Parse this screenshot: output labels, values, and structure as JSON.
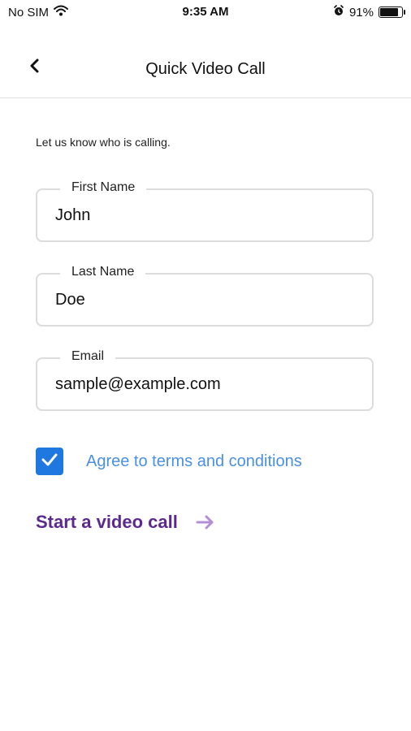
{
  "status_bar": {
    "carrier": "No SIM",
    "time": "9:35 AM",
    "battery_percent": "91%",
    "battery_level": 0.91,
    "icons": [
      "wifi-icon",
      "alarm-icon",
      "battery-icon"
    ]
  },
  "nav": {
    "title": "Quick Video Call",
    "back_icon": "chevron-left-icon"
  },
  "form": {
    "intro": "Let us know who is calling.",
    "first_name": {
      "label": "First Name",
      "value": "John"
    },
    "last_name": {
      "label": "Last Name",
      "value": "Doe"
    },
    "email": {
      "label": "Email",
      "value": "sample@example.com"
    },
    "agree": {
      "label": "Agree to terms and conditions",
      "checked": true
    }
  },
  "action": {
    "start_label": "Start a video call",
    "arrow_icon": "arrow-right-icon"
  },
  "colors": {
    "accent_blue": "#1e78e0",
    "link_blue": "#4a90e2",
    "action_purple": "#5b2a8f",
    "arrow_purple": "#b48fd6"
  }
}
